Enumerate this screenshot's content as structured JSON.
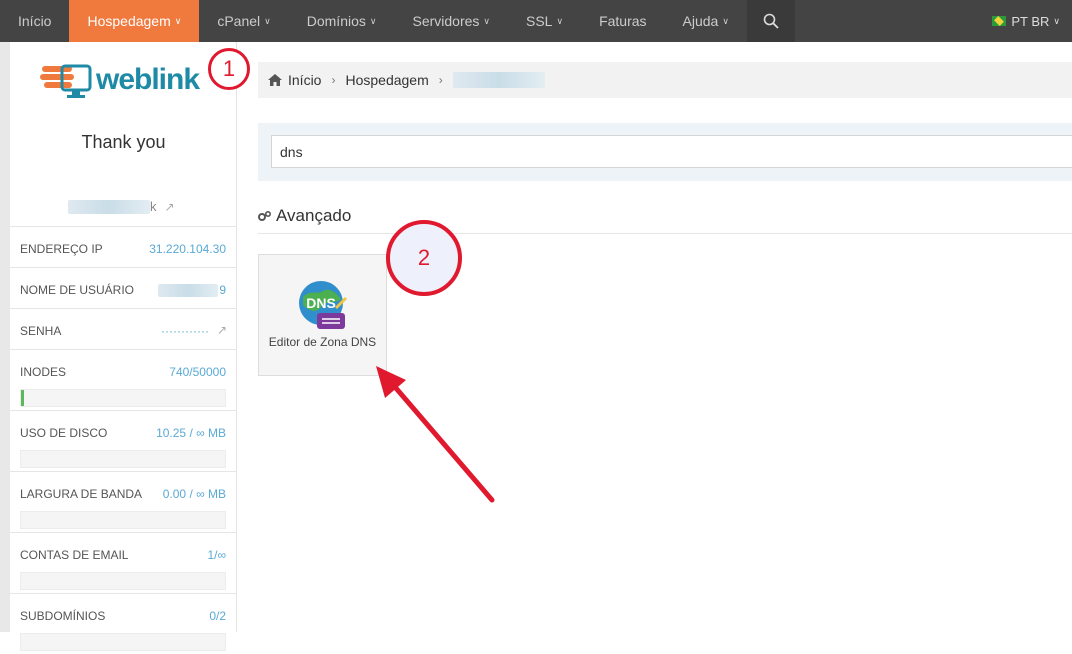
{
  "nav": {
    "items": [
      {
        "label": "Início",
        "chevron": false
      },
      {
        "label": "Hospedagem",
        "chevron": true,
        "active": true
      },
      {
        "label": "cPanel",
        "chevron": true
      },
      {
        "label": "Domínios",
        "chevron": true
      },
      {
        "label": "Servidores",
        "chevron": true
      },
      {
        "label": "SSL",
        "chevron": true
      },
      {
        "label": "Faturas",
        "chevron": false
      },
      {
        "label": "Ajuda",
        "chevron": true
      }
    ],
    "language": "PT BR"
  },
  "sidebar": {
    "logo_text": "weblink",
    "title": "Thank you",
    "domain_suffix": "k",
    "rows": [
      {
        "label": "ENDEREÇO IP",
        "value": "31.220.104.30"
      },
      {
        "label": "NOME DE USUÁRIO",
        "value": "9"
      },
      {
        "label": "SENHA",
        "value": "············"
      },
      {
        "label": "INODES",
        "value": "740/50000",
        "fill": 0.0148
      },
      {
        "label": "USO DE DISCO",
        "value": "10.25 / ∞ MB",
        "fill": 0
      },
      {
        "label": "LARGURA DE BANDA",
        "value": "0.00 / ∞ MB",
        "fill": 0
      },
      {
        "label": "CONTAS DE EMAIL",
        "value": "1/∞",
        "fill": 0
      },
      {
        "label": "SUBDOMÍNIOS",
        "value": "0/2",
        "fill": 0
      }
    ]
  },
  "breadcrumb": {
    "home": "Início",
    "section": "Hospedagem"
  },
  "search": {
    "value": "dns"
  },
  "section": {
    "title": "Avançado"
  },
  "tile": {
    "label": "Editor de Zona DNS",
    "icon_text": "DNS"
  },
  "annotations": {
    "step1": "1",
    "step2": "2"
  },
  "colors": {
    "accent": "#f07a3d",
    "annotation": "#e0192f",
    "link": "#5aa9d6"
  }
}
